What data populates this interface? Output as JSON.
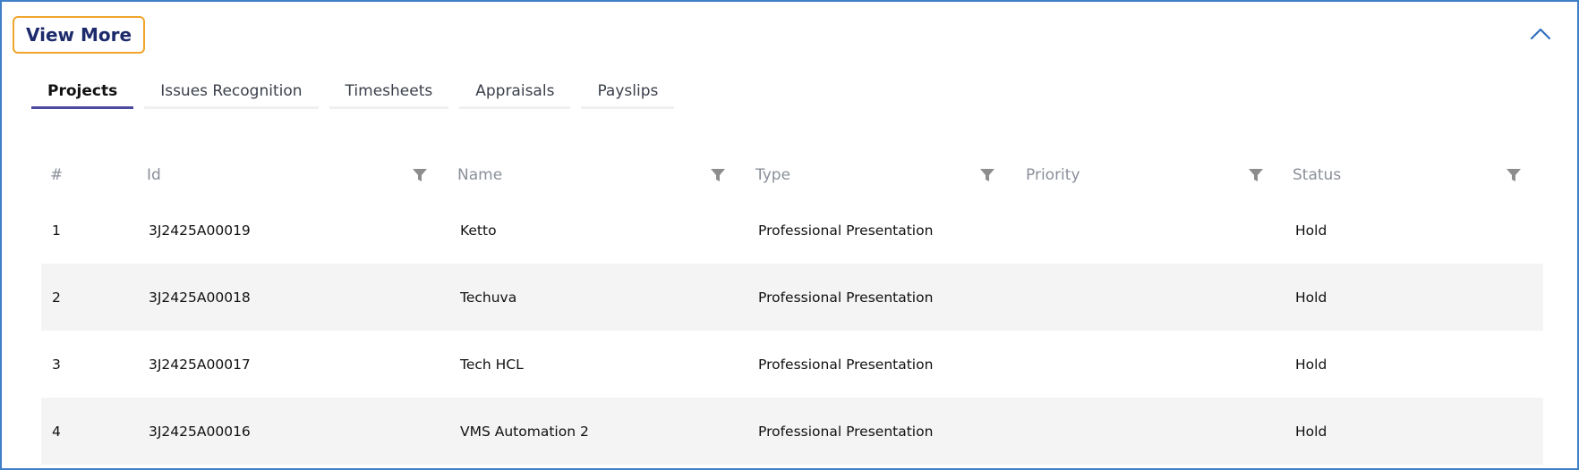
{
  "panel": {
    "view_more_label": "View More",
    "collapse_icon": "chevron-up-icon",
    "accent_color": "#4b4a9e",
    "border_color": "#3f7fc8",
    "highlight_color": "#f0a52c"
  },
  "tabs": [
    {
      "label": "Projects",
      "active": true
    },
    {
      "label": "Issues Recognition",
      "active": false
    },
    {
      "label": "Timesheets",
      "active": false
    },
    {
      "label": "Appraisals",
      "active": false
    },
    {
      "label": "Payslips",
      "active": false
    }
  ],
  "table": {
    "columns": [
      "#",
      "Id",
      "Name",
      "Type",
      "Priority",
      "Status"
    ],
    "filter_icon": "filter-icon",
    "rows": [
      {
        "num": "1",
        "id": "3J2425A00019",
        "name": "Ketto",
        "type": "Professional Presentation",
        "priority": "",
        "status": "Hold"
      },
      {
        "num": "2",
        "id": "3J2425A00018",
        "name": "Techuva",
        "type": "Professional Presentation",
        "priority": "",
        "status": "Hold"
      },
      {
        "num": "3",
        "id": "3J2425A00017",
        "name": "Tech HCL",
        "type": "Professional Presentation",
        "priority": "",
        "status": "Hold"
      },
      {
        "num": "4",
        "id": "3J2425A00016",
        "name": "VMS Automation 2",
        "type": "Professional Presentation",
        "priority": "",
        "status": "Hold"
      }
    ]
  }
}
